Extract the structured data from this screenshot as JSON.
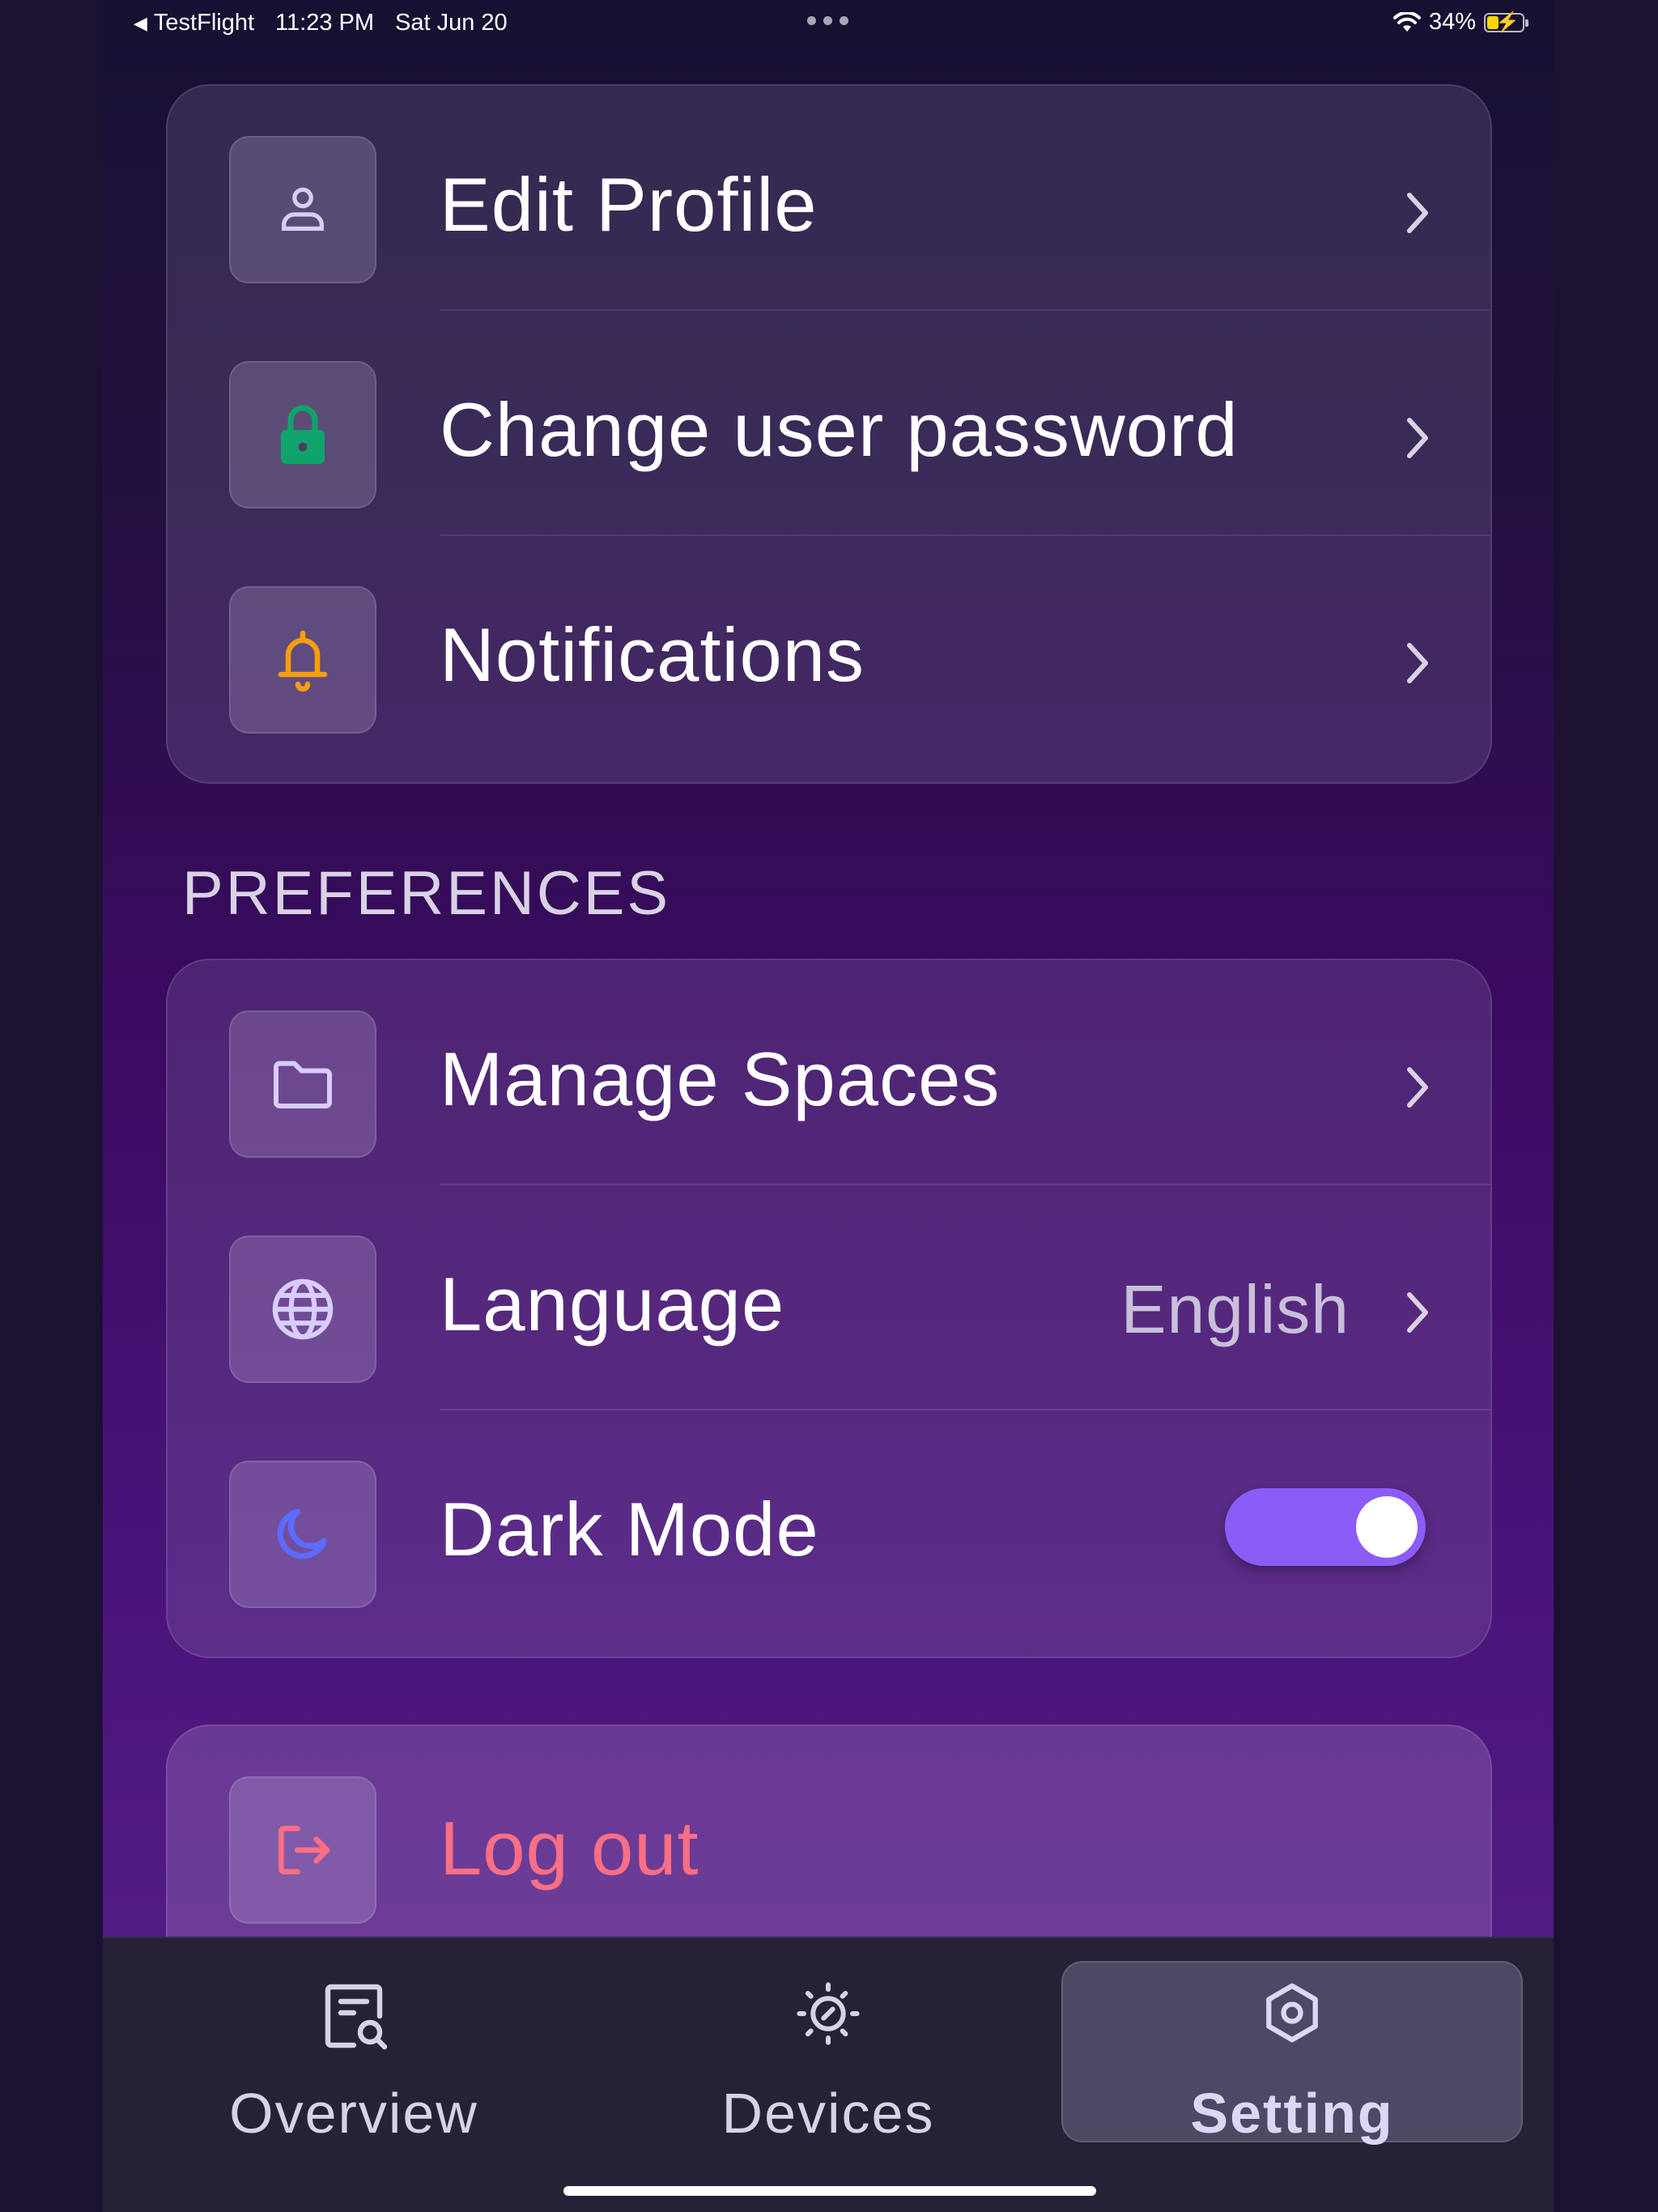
{
  "status_bar": {
    "back_app": "TestFlight",
    "time": "11:23 PM",
    "date": "Sat Jun 20",
    "battery": "34%"
  },
  "account_card": {
    "items": [
      {
        "label": "Edit Profile",
        "icon": "user-icon"
      },
      {
        "label": "Change user password",
        "icon": "lock-icon"
      },
      {
        "label": "Notifications",
        "icon": "bell-icon"
      }
    ]
  },
  "preferences": {
    "title": "PREFERENCES",
    "items": [
      {
        "label": "Manage Spaces",
        "icon": "folder-icon"
      },
      {
        "label": "Language",
        "icon": "globe-icon",
        "value": "English"
      },
      {
        "label": "Dark Mode",
        "icon": "moon-icon",
        "toggle_on": true
      }
    ]
  },
  "logout": {
    "label": "Log out",
    "icon": "logout-icon",
    "color": "#fb6f84"
  },
  "tabs": [
    {
      "label": "Overview",
      "icon": "report-search-icon",
      "active": false
    },
    {
      "label": "Devices",
      "icon": "devices-icon",
      "active": false
    },
    {
      "label": "Setting",
      "icon": "settings-hexagon-icon",
      "active": true
    }
  ],
  "colors": {
    "accent": "#8b5cf6",
    "lock_icon": "#10a36b",
    "bell_icon": "#f59e0b",
    "moon_icon": "#5b6cff",
    "logout": "#fb6f84"
  }
}
